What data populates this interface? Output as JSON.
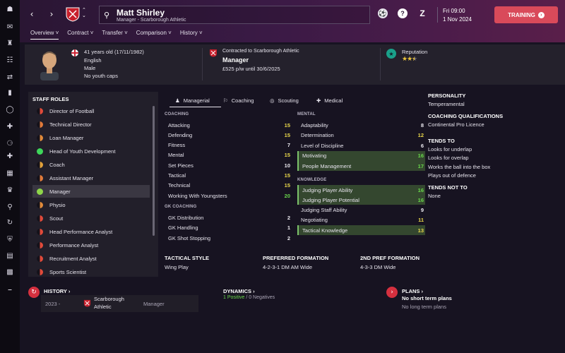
{
  "header": {
    "manager_name": "Matt Shirley",
    "manager_subtitle": "Manager - Scarborough Athletic",
    "date_day": "Fri 09:00",
    "date_full": "1 Nov 2024",
    "training_label": "TRAINING"
  },
  "tabs": [
    {
      "label": "Overview"
    },
    {
      "label": "Contract"
    },
    {
      "label": "Transfer"
    },
    {
      "label": "Comparison"
    },
    {
      "label": "History"
    }
  ],
  "info": {
    "age": "41 years old (17/11/1982)",
    "nationality": "English",
    "gender": "Male",
    "youth_caps": "No youth caps",
    "contract_line": "Contracted to Scarborough Athletic",
    "role": "Manager",
    "wage": "£525 p/w until 30/6/2025",
    "reputation_label": "Reputation",
    "reputation_stars": 2.5
  },
  "staff_roles": {
    "title": "STAFF ROLES",
    "items": [
      {
        "label": "Director of Football",
        "color": "#e04a3a"
      },
      {
        "label": "Technical Director",
        "color": "#e07a3a"
      },
      {
        "label": "Loan Manager",
        "color": "#e08a3a"
      },
      {
        "label": "Head of Youth Development",
        "color": "#3ed65a"
      },
      {
        "label": "Coach",
        "color": "#e0a03a"
      },
      {
        "label": "Assistant Manager",
        "color": "#e07a3a"
      },
      {
        "label": "Manager",
        "color": "#8ed64a"
      },
      {
        "label": "Physio",
        "color": "#e08a3a"
      },
      {
        "label": "Scout",
        "color": "#e04a3a"
      },
      {
        "label": "Head Performance Analyst",
        "color": "#e04a3a"
      },
      {
        "label": "Performance Analyst",
        "color": "#e04a3a"
      },
      {
        "label": "Recruitment Analyst",
        "color": "#e04a3a"
      },
      {
        "label": "Sports Scientist",
        "color": "#e04a3a"
      }
    ]
  },
  "attr_tabs": [
    {
      "label": "Managerial"
    },
    {
      "label": "Coaching"
    },
    {
      "label": "Scouting"
    },
    {
      "label": "Medical"
    }
  ],
  "coaching": {
    "title": "COACHING",
    "rows": [
      {
        "label": "Attacking",
        "value": "15"
      },
      {
        "label": "Defending",
        "value": "15"
      },
      {
        "label": "Fitness",
        "value": "7"
      },
      {
        "label": "Mental",
        "value": "15"
      },
      {
        "label": "Set Pieces",
        "value": "10"
      },
      {
        "label": "Tactical",
        "value": "15"
      },
      {
        "label": "Technical",
        "value": "15"
      },
      {
        "label": "Working With Youngsters",
        "value": "20"
      }
    ]
  },
  "gk_coaching": {
    "title": "GK COACHING",
    "rows": [
      {
        "label": "GK Distribution",
        "value": "2"
      },
      {
        "label": "GK Handling",
        "value": "1"
      },
      {
        "label": "GK Shot Stopping",
        "value": "2"
      }
    ]
  },
  "mental": {
    "title": "MENTAL",
    "rows": [
      {
        "label": "Adaptability",
        "value": "8"
      },
      {
        "label": "Determination",
        "value": "12"
      },
      {
        "label": "Level of Discipline",
        "value": "6"
      },
      {
        "label": "Motivating",
        "value": "16"
      },
      {
        "label": "People Management",
        "value": "17"
      }
    ]
  },
  "knowledge": {
    "title": "KNOWLEDGE",
    "rows": [
      {
        "label": "Judging Player Ability",
        "value": "16"
      },
      {
        "label": "Judging Player Potential",
        "value": "16"
      },
      {
        "label": "Judging Staff Ability",
        "value": "9"
      },
      {
        "label": "Negotiating",
        "value": "11"
      },
      {
        "label": "Tactical Knowledge",
        "value": "13"
      }
    ]
  },
  "tactics": {
    "style_title": "TACTICAL STYLE",
    "style_value": "Wing Play",
    "formation_title": "PREFERRED FORMATION",
    "formation_value": "4-2-3-1 DM AM Wide",
    "formation2_title": "2ND PREF FORMATION",
    "formation2_value": "4-3-3 DM Wide"
  },
  "right_panel": {
    "personality_title": "PERSONALITY",
    "personality_value": "Temperamental",
    "qual_title": "COACHING QUALIFICATIONS",
    "qual_value": "Continental Pro Licence",
    "tends_to_title": "TENDS TO",
    "tends_to": [
      "Looks for underlap",
      "Looks for overlap",
      "Works the ball into the box",
      "Plays out of defence"
    ],
    "tends_not_title": "TENDS NOT TO",
    "tends_not_value": "None"
  },
  "bottom": {
    "history_title": "HISTORY",
    "history_year": "2023 -",
    "history_club_1": "Scarborough",
    "history_club_2": "Athletic",
    "history_role": "Manager",
    "dynamics_title": "DYNAMICS",
    "dynamics_positive": "1 Positive",
    "dynamics_sep": "/",
    "dynamics_negative": "0 Negatives",
    "plans_title": "PLANS",
    "plans_line1": "No short term plans",
    "plans_line2": "No long term plans"
  }
}
